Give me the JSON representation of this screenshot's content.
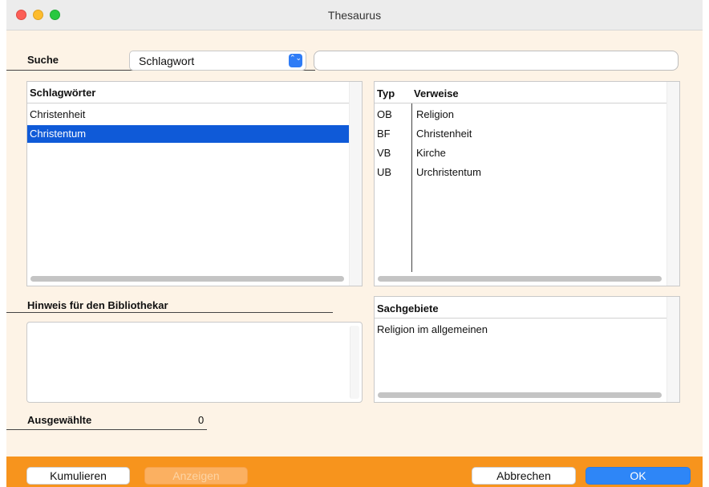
{
  "window": {
    "title": "Thesaurus"
  },
  "search": {
    "label": "Suche",
    "field_selected": "Schlagwort",
    "query_value": "",
    "select_arrows": "⌃⌄"
  },
  "keywords": {
    "header": "Schlagwörter",
    "items": [
      "Christenheit",
      "Christentum"
    ],
    "selected_index": 1
  },
  "references": {
    "col_type": "Typ",
    "col_ref": "Verweise",
    "rows": [
      {
        "type": "OB",
        "ref": "Religion"
      },
      {
        "type": "BF",
        "ref": "Christenheit"
      },
      {
        "type": "VB",
        "ref": "Kirche"
      },
      {
        "type": "UB",
        "ref": "Urchristentum"
      }
    ]
  },
  "note": {
    "label": "Hinweis für den Bibliothekar",
    "value": ""
  },
  "subjects": {
    "header": "Sachgebiete",
    "items": [
      "Religion im allgemeinen"
    ]
  },
  "selected_count": {
    "label": "Ausgewählte",
    "value": "0"
  },
  "buttons": {
    "cumulate": "Kumulieren",
    "show": "Anzeigen",
    "cancel": "Abbrechen",
    "ok": "OK"
  },
  "colors": {
    "accent_bar": "#f7941d",
    "selection": "#0f5ad8",
    "primary_button": "#2e86f7",
    "window_bg": "#fdf3e6"
  }
}
